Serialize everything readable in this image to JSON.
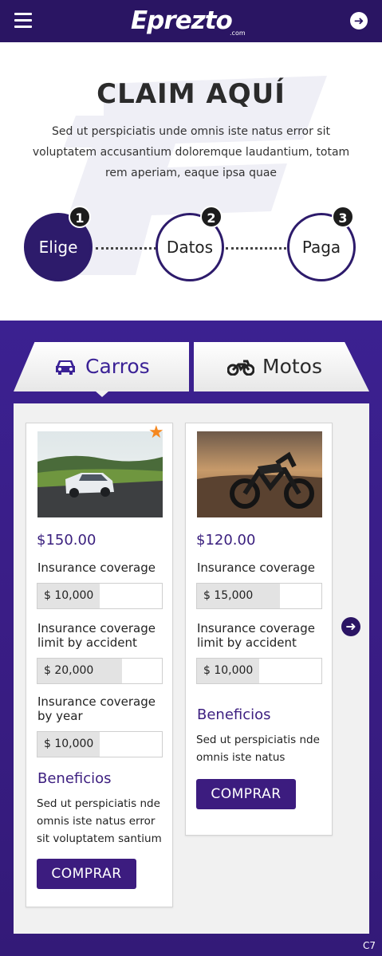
{
  "header": {
    "logo_text": "Eprezto",
    "logo_sub": ".com",
    "menu_icon": "hamburger-icon",
    "next_icon": "arrow-right-circle-icon"
  },
  "hero": {
    "title": "CLAIM AQUÍ",
    "description": "Sed ut perspiciatis unde omnis iste natus error sit voluptatem accusantium doloremque laudantium, totam rem aperiam, eaque ipsa quae"
  },
  "steps": [
    {
      "number": "1",
      "label": "Elige",
      "active": true
    },
    {
      "number": "2",
      "label": "Datos",
      "active": false
    },
    {
      "number": "3",
      "label": "Paga",
      "active": false
    }
  ],
  "tabs": [
    {
      "label": "Carros",
      "icon": "car-icon",
      "active": true
    },
    {
      "label": "Motos",
      "icon": "motorcycle-icon",
      "active": false
    }
  ],
  "cards": [
    {
      "image": "car-photo",
      "featured": true,
      "price": "$150.00",
      "fields": [
        {
          "label": "Insurance coverage",
          "value": "$ 10,000"
        },
        {
          "label": "Insurance coverage limit by accident",
          "value": "$ 20,000"
        },
        {
          "label": "Insurance coverage by year",
          "value": "$ 10,000"
        }
      ],
      "benefits_title": "Beneficios",
      "benefits_text": "Sed ut perspiciatis nde omnis iste natus error sit voluptatem santium",
      "button": "COMPRAR"
    },
    {
      "image": "motorcycle-photo",
      "featured": false,
      "price": "$120.00",
      "fields": [
        {
          "label": "Insurance coverage",
          "value": "$ 15,000"
        },
        {
          "label": "Insurance coverage limit by accident",
          "value": "$ 10,000"
        }
      ],
      "benefits_title": "Beneficios",
      "benefits_text": "Sed ut perspiciatis nde omnis iste natus",
      "button": "COMPRAR"
    }
  ],
  "carousel_next_icon": "arrow-right-circle-icon",
  "corner_label": "C7",
  "colors": {
    "primary": "#2a1563",
    "accent": "#3b2296",
    "star": "#f5871f",
    "panel": "#f1f1f1"
  }
}
